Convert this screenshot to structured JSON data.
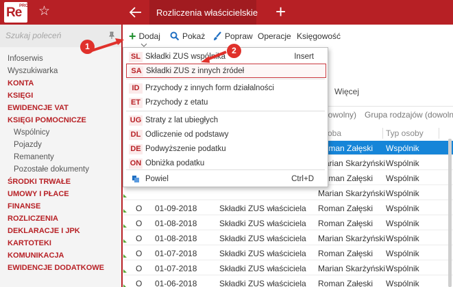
{
  "topbar": {
    "logo_text": "Re",
    "logo_sub": "PRO",
    "star_glyph": "☆",
    "active_tab": "Rozliczenia właścicielskie",
    "add_tab_glyph": "+"
  },
  "sidebar": {
    "search_placeholder": "Szukaj poleceń",
    "pin_glyph": "📌",
    "items": [
      {
        "label": "Infoserwis",
        "style": "plain"
      },
      {
        "label": "Wyszukiwarka",
        "style": "plain"
      },
      {
        "label": "KONTA",
        "style": "red"
      },
      {
        "label": "KSIĘGI",
        "style": "red"
      },
      {
        "label": "EWIDENCJE VAT",
        "style": "red"
      },
      {
        "label": "KSIĘGI POMOCNICZE",
        "style": "red"
      },
      {
        "label": "Wspólnicy",
        "style": "sub"
      },
      {
        "label": "Pojazdy",
        "style": "sub"
      },
      {
        "label": "Remanenty",
        "style": "sub"
      },
      {
        "label": "Pozostałe dokumenty",
        "style": "sub"
      },
      {
        "label": "ŚRODKI TRWAŁE",
        "style": "red"
      },
      {
        "label": "UMOWY I PŁACE",
        "style": "red"
      },
      {
        "label": "FINANSE",
        "style": "red"
      },
      {
        "label": "ROZLICZENIA",
        "style": "red"
      },
      {
        "label": "DEKLARACJE I JPK",
        "style": "red"
      },
      {
        "label": "KARTOTEKI",
        "style": "red"
      },
      {
        "label": "KOMUNIKACJA",
        "style": "red"
      },
      {
        "label": "EWIDENCJE DODATKOWE",
        "style": "red"
      }
    ]
  },
  "toolbar": {
    "add_label": "Dodaj",
    "show_label": "Pokaż",
    "edit_label": "Popraw",
    "operations_label": "Operacje",
    "accounting_label": "Księgowość"
  },
  "grid": {
    "more_label": "Więcej",
    "filter1": "dowolny)",
    "filter2": "Grupa rodzajów (dowolny)",
    "headers": {
      "person": "oba",
      "type": "Typ osoby"
    },
    "rows": [
      {
        "status": "",
        "date": "",
        "desc": "",
        "person": "Roman Załęski",
        "type": "Wspólnik",
        "selected": true
      },
      {
        "status": "",
        "date": "",
        "desc": "",
        "person": "Marian Skarżyński",
        "type": "Wspólnik",
        "selected": false
      },
      {
        "status": "",
        "date": "",
        "desc": "",
        "person": "Roman Załęski",
        "type": "Wspólnik",
        "selected": false
      },
      {
        "status": "",
        "date": "",
        "desc": "",
        "person": "Marian Skarżyński",
        "type": "Wspólnik",
        "selected": false
      },
      {
        "status": "O",
        "date": "01-09-2018",
        "desc": "Składki ZUS właściciela",
        "person": "Roman Załęski",
        "type": "Wspólnik",
        "selected": false
      },
      {
        "status": "O",
        "date": "01-08-2018",
        "desc": "Składki ZUS właściciela",
        "person": "Roman Załęski",
        "type": "Wspólnik",
        "selected": false
      },
      {
        "status": "O",
        "date": "01-08-2018",
        "desc": "Składki ZUS właściciela",
        "person": "Marian Skarżyński",
        "type": "Wspólnik",
        "selected": false
      },
      {
        "status": "O",
        "date": "01-07-2018",
        "desc": "Składki ZUS właściciela",
        "person": "Roman Załęski",
        "type": "Wspólnik",
        "selected": false
      },
      {
        "status": "O",
        "date": "01-07-2018",
        "desc": "Składki ZUS właściciela",
        "person": "Marian Skarżyński",
        "type": "Wspólnik",
        "selected": false
      },
      {
        "status": "O",
        "date": "01-06-2018",
        "desc": "Składki ZUS właściciela",
        "person": "Roman Załęski",
        "type": "Wspólnik",
        "selected": false
      }
    ]
  },
  "menu": {
    "items": [
      {
        "code": "SL",
        "label": "Składki ZUS wspólnika",
        "shortcut": "Insert",
        "highlighted": false
      },
      {
        "code": "SA",
        "label": "Składki ZUS z innych źródeł",
        "shortcut": "",
        "highlighted": true
      },
      {
        "code": "ID",
        "label": "Przychody z innych form działalności",
        "shortcut": "",
        "highlighted": false
      },
      {
        "code": "ET",
        "label": "Przychody z etatu",
        "shortcut": "",
        "highlighted": false
      },
      {
        "code": "UG",
        "label": "Straty z lat ubiegłych",
        "shortcut": "",
        "highlighted": false
      },
      {
        "code": "DL",
        "label": "Odliczenie od podstawy",
        "shortcut": "",
        "highlighted": false
      },
      {
        "code": "DE",
        "label": "Podwyższenie podatku",
        "shortcut": "",
        "highlighted": false
      },
      {
        "code": "ON",
        "label": "Obniżka podatku",
        "shortcut": "",
        "highlighted": false
      },
      {
        "code": "",
        "label": "Powiel",
        "shortcut": "Ctrl+D",
        "highlighted": false
      }
    ]
  },
  "callouts": {
    "step1": "1",
    "step2": "2"
  },
  "colors": {
    "brand": "#b72025",
    "selection": "#1685d8",
    "add_green": "#1f8f2e",
    "callout": "#e0312b"
  }
}
